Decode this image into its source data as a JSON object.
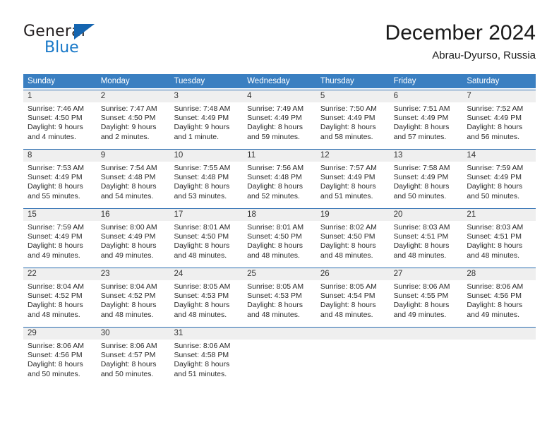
{
  "logo": {
    "text_top": "General",
    "text_bottom": "Blue",
    "triangle_color": "#1565b0",
    "blue_color": "#1878c8"
  },
  "header": {
    "title": "December 2024",
    "subtitle": "Abrau-Dyurso, Russia"
  },
  "theme": {
    "header_blue": "#3a7fc1",
    "cell_top_border": "#2a6cb0",
    "day_band_gray": "#efefef"
  },
  "calendar": {
    "weekdays": [
      "Sunday",
      "Monday",
      "Tuesday",
      "Wednesday",
      "Thursday",
      "Friday",
      "Saturday"
    ],
    "weeks": [
      [
        {
          "day": "1",
          "sunrise": "Sunrise: 7:46 AM",
          "sunset": "Sunset: 4:50 PM",
          "daylight1": "Daylight: 9 hours",
          "daylight2": "and 4 minutes."
        },
        {
          "day": "2",
          "sunrise": "Sunrise: 7:47 AM",
          "sunset": "Sunset: 4:50 PM",
          "daylight1": "Daylight: 9 hours",
          "daylight2": "and 2 minutes."
        },
        {
          "day": "3",
          "sunrise": "Sunrise: 7:48 AM",
          "sunset": "Sunset: 4:49 PM",
          "daylight1": "Daylight: 9 hours",
          "daylight2": "and 1 minute."
        },
        {
          "day": "4",
          "sunrise": "Sunrise: 7:49 AM",
          "sunset": "Sunset: 4:49 PM",
          "daylight1": "Daylight: 8 hours",
          "daylight2": "and 59 minutes."
        },
        {
          "day": "5",
          "sunrise": "Sunrise: 7:50 AM",
          "sunset": "Sunset: 4:49 PM",
          "daylight1": "Daylight: 8 hours",
          "daylight2": "and 58 minutes."
        },
        {
          "day": "6",
          "sunrise": "Sunrise: 7:51 AM",
          "sunset": "Sunset: 4:49 PM",
          "daylight1": "Daylight: 8 hours",
          "daylight2": "and 57 minutes."
        },
        {
          "day": "7",
          "sunrise": "Sunrise: 7:52 AM",
          "sunset": "Sunset: 4:49 PM",
          "daylight1": "Daylight: 8 hours",
          "daylight2": "and 56 minutes."
        }
      ],
      [
        {
          "day": "8",
          "sunrise": "Sunrise: 7:53 AM",
          "sunset": "Sunset: 4:49 PM",
          "daylight1": "Daylight: 8 hours",
          "daylight2": "and 55 minutes."
        },
        {
          "day": "9",
          "sunrise": "Sunrise: 7:54 AM",
          "sunset": "Sunset: 4:48 PM",
          "daylight1": "Daylight: 8 hours",
          "daylight2": "and 54 minutes."
        },
        {
          "day": "10",
          "sunrise": "Sunrise: 7:55 AM",
          "sunset": "Sunset: 4:48 PM",
          "daylight1": "Daylight: 8 hours",
          "daylight2": "and 53 minutes."
        },
        {
          "day": "11",
          "sunrise": "Sunrise: 7:56 AM",
          "sunset": "Sunset: 4:48 PM",
          "daylight1": "Daylight: 8 hours",
          "daylight2": "and 52 minutes."
        },
        {
          "day": "12",
          "sunrise": "Sunrise: 7:57 AM",
          "sunset": "Sunset: 4:49 PM",
          "daylight1": "Daylight: 8 hours",
          "daylight2": "and 51 minutes."
        },
        {
          "day": "13",
          "sunrise": "Sunrise: 7:58 AM",
          "sunset": "Sunset: 4:49 PM",
          "daylight1": "Daylight: 8 hours",
          "daylight2": "and 50 minutes."
        },
        {
          "day": "14",
          "sunrise": "Sunrise: 7:59 AM",
          "sunset": "Sunset: 4:49 PM",
          "daylight1": "Daylight: 8 hours",
          "daylight2": "and 50 minutes."
        }
      ],
      [
        {
          "day": "15",
          "sunrise": "Sunrise: 7:59 AM",
          "sunset": "Sunset: 4:49 PM",
          "daylight1": "Daylight: 8 hours",
          "daylight2": "and 49 minutes."
        },
        {
          "day": "16",
          "sunrise": "Sunrise: 8:00 AM",
          "sunset": "Sunset: 4:49 PM",
          "daylight1": "Daylight: 8 hours",
          "daylight2": "and 49 minutes."
        },
        {
          "day": "17",
          "sunrise": "Sunrise: 8:01 AM",
          "sunset": "Sunset: 4:50 PM",
          "daylight1": "Daylight: 8 hours",
          "daylight2": "and 48 minutes."
        },
        {
          "day": "18",
          "sunrise": "Sunrise: 8:01 AM",
          "sunset": "Sunset: 4:50 PM",
          "daylight1": "Daylight: 8 hours",
          "daylight2": "and 48 minutes."
        },
        {
          "day": "19",
          "sunrise": "Sunrise: 8:02 AM",
          "sunset": "Sunset: 4:50 PM",
          "daylight1": "Daylight: 8 hours",
          "daylight2": "and 48 minutes."
        },
        {
          "day": "20",
          "sunrise": "Sunrise: 8:03 AM",
          "sunset": "Sunset: 4:51 PM",
          "daylight1": "Daylight: 8 hours",
          "daylight2": "and 48 minutes."
        },
        {
          "day": "21",
          "sunrise": "Sunrise: 8:03 AM",
          "sunset": "Sunset: 4:51 PM",
          "daylight1": "Daylight: 8 hours",
          "daylight2": "and 48 minutes."
        }
      ],
      [
        {
          "day": "22",
          "sunrise": "Sunrise: 8:04 AM",
          "sunset": "Sunset: 4:52 PM",
          "daylight1": "Daylight: 8 hours",
          "daylight2": "and 48 minutes."
        },
        {
          "day": "23",
          "sunrise": "Sunrise: 8:04 AM",
          "sunset": "Sunset: 4:52 PM",
          "daylight1": "Daylight: 8 hours",
          "daylight2": "and 48 minutes."
        },
        {
          "day": "24",
          "sunrise": "Sunrise: 8:05 AM",
          "sunset": "Sunset: 4:53 PM",
          "daylight1": "Daylight: 8 hours",
          "daylight2": "and 48 minutes."
        },
        {
          "day": "25",
          "sunrise": "Sunrise: 8:05 AM",
          "sunset": "Sunset: 4:53 PM",
          "daylight1": "Daylight: 8 hours",
          "daylight2": "and 48 minutes."
        },
        {
          "day": "26",
          "sunrise": "Sunrise: 8:05 AM",
          "sunset": "Sunset: 4:54 PM",
          "daylight1": "Daylight: 8 hours",
          "daylight2": "and 48 minutes."
        },
        {
          "day": "27",
          "sunrise": "Sunrise: 8:06 AM",
          "sunset": "Sunset: 4:55 PM",
          "daylight1": "Daylight: 8 hours",
          "daylight2": "and 49 minutes."
        },
        {
          "day": "28",
          "sunrise": "Sunrise: 8:06 AM",
          "sunset": "Sunset: 4:56 PM",
          "daylight1": "Daylight: 8 hours",
          "daylight2": "and 49 minutes."
        }
      ],
      [
        {
          "day": "29",
          "sunrise": "Sunrise: 8:06 AM",
          "sunset": "Sunset: 4:56 PM",
          "daylight1": "Daylight: 8 hours",
          "daylight2": "and 50 minutes."
        },
        {
          "day": "30",
          "sunrise": "Sunrise: 8:06 AM",
          "sunset": "Sunset: 4:57 PM",
          "daylight1": "Daylight: 8 hours",
          "daylight2": "and 50 minutes."
        },
        {
          "day": "31",
          "sunrise": "Sunrise: 8:06 AM",
          "sunset": "Sunset: 4:58 PM",
          "daylight1": "Daylight: 8 hours",
          "daylight2": "and 51 minutes."
        },
        {
          "day": "",
          "sunrise": "",
          "sunset": "",
          "daylight1": "",
          "daylight2": ""
        },
        {
          "day": "",
          "sunrise": "",
          "sunset": "",
          "daylight1": "",
          "daylight2": ""
        },
        {
          "day": "",
          "sunrise": "",
          "sunset": "",
          "daylight1": "",
          "daylight2": ""
        },
        {
          "day": "",
          "sunrise": "",
          "sunset": "",
          "daylight1": "",
          "daylight2": ""
        }
      ]
    ]
  }
}
